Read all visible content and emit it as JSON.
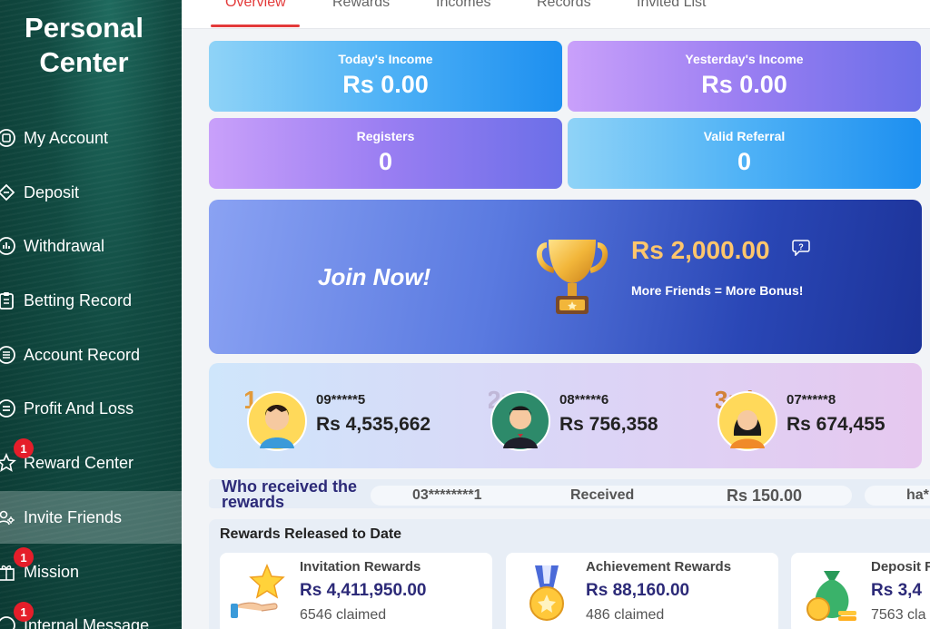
{
  "sidebar": {
    "title_line1": "Personal",
    "title_line2": "Center",
    "items": [
      {
        "label": "My Account",
        "icon": "wallet-icon"
      },
      {
        "label": "Deposit",
        "icon": "ticket-icon"
      },
      {
        "label": "Withdrawal",
        "icon": "chart-circle-icon"
      },
      {
        "label": "Betting Record",
        "icon": "clipboard-icon"
      },
      {
        "label": "Account Record",
        "icon": "list-circle-icon"
      },
      {
        "label": "Profit And Loss",
        "icon": "list-circle-icon"
      },
      {
        "label": "Reward Center",
        "icon": "star-icon",
        "badge": "1"
      },
      {
        "label": "Invite Friends",
        "icon": "users-icon"
      },
      {
        "label": "Mission",
        "icon": "gift-icon",
        "badge": "1"
      },
      {
        "label": "Internal Message",
        "icon": "message-icon",
        "badge": "1"
      }
    ]
  },
  "tabs": [
    "Overview",
    "Rewards",
    "Incomes",
    "Records",
    "Invited List"
  ],
  "stats": {
    "todays_income": {
      "label": "Today's Income",
      "value": "Rs  0.00"
    },
    "yesterdays_income": {
      "label": "Yesterday's Income",
      "value": "Rs  0.00"
    },
    "registers": {
      "label": "Registers",
      "value": "0"
    },
    "valid_referral": {
      "label": "Valid Referral",
      "value": "0"
    }
  },
  "banner": {
    "join": "Join Now!",
    "prize": "Rs  2,000.00",
    "subtitle": "More Friends = More Bonus!"
  },
  "ranking": [
    {
      "rank_mark": "1st",
      "phone": "09*****5",
      "amount": "Rs 4,535,662"
    },
    {
      "rank_mark": "2nd",
      "phone": "08*****6",
      "amount": "Rs 756,358"
    },
    {
      "rank_mark": "3rd",
      "phone": "07*****8",
      "amount": "Rs 674,455"
    }
  ],
  "ticker": {
    "title": "Who received the rewards",
    "user": "03********1",
    "status": "Received",
    "amount": "Rs  150.00",
    "next": "ha*"
  },
  "released": {
    "heading": "Rewards Released to Date",
    "cards": [
      {
        "title": "Invitation Rewards",
        "value": "Rs  4,411,950.00",
        "claimed": "6546 claimed"
      },
      {
        "title": "Achievement Rewards",
        "value": "Rs  88,160.00",
        "claimed": "486 claimed"
      },
      {
        "title": "Deposit R",
        "value": "Rs  3,4",
        "claimed": "7563 cla"
      }
    ]
  },
  "colors": {
    "accent": "#e33a3a",
    "sidebar": "#114a41",
    "navy": "#2c2a78",
    "gold": "#ffc66b"
  }
}
